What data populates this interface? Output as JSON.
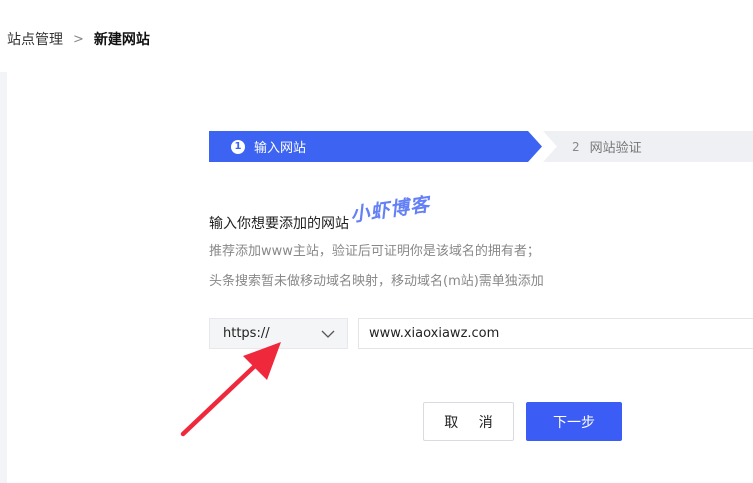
{
  "breadcrumb": {
    "parent": "站点管理",
    "separator": ">",
    "current": "新建网站"
  },
  "steps": [
    {
      "number": "1",
      "label": "输入网站",
      "active": true
    },
    {
      "number": "2",
      "label": "网站验证",
      "active": false
    }
  ],
  "form": {
    "heading": "输入你想要添加的网站",
    "desc_line1": "推荐添加www主站，验证后可证明你是该域名的拥有者；",
    "desc_line2": "头条搜索暂未做移动域名映射，移动域名(m站)需单独添加",
    "protocol": "https://",
    "domain_value": "www.xiaoxiawz.com"
  },
  "buttons": {
    "cancel": "取 消",
    "next": "下一步"
  },
  "watermark": "小虾博客",
  "colors": {
    "accent": "#3c63f1",
    "arrow": "#f0283c"
  }
}
